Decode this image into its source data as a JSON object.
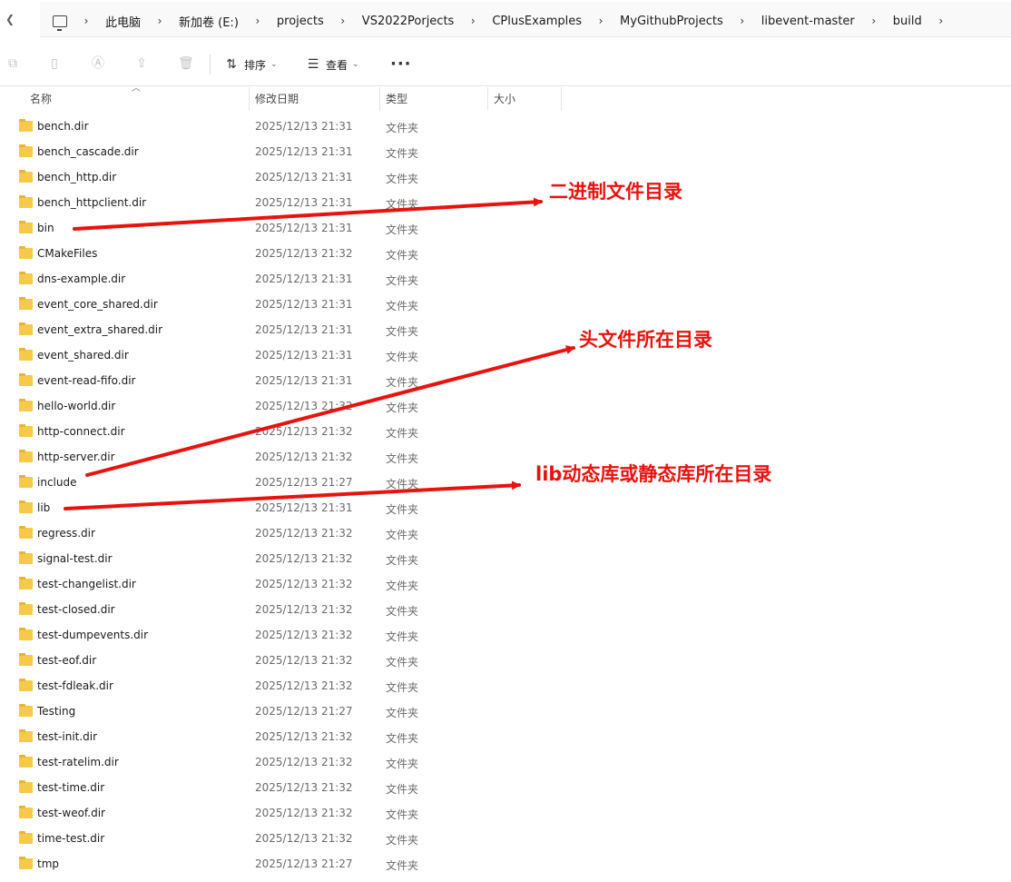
{
  "address_bar": {
    "crumbs": [
      "此电脑",
      "新加卷 (E:)",
      "projects",
      "VS2022Porjects",
      "CPlusExamples",
      "MyGithubProjects",
      "libevent-master",
      "build"
    ]
  },
  "toolbar": {
    "sort_label": "排序",
    "view_label": "查看",
    "more_label": "···"
  },
  "columns": {
    "name": "名称",
    "modified": "修改日期",
    "type": "类型",
    "size": "大小"
  },
  "files": [
    {
      "name": "bench.dir",
      "date": "2025/12/13 21:31",
      "type": "文件夹"
    },
    {
      "name": "bench_cascade.dir",
      "date": "2025/12/13 21:31",
      "type": "文件夹"
    },
    {
      "name": "bench_http.dir",
      "date": "2025/12/13 21:31",
      "type": "文件夹"
    },
    {
      "name": "bench_httpclient.dir",
      "date": "2025/12/13 21:31",
      "type": "文件夹"
    },
    {
      "name": "bin",
      "date": "2025/12/13 21:31",
      "type": "文件夹"
    },
    {
      "name": "CMakeFiles",
      "date": "2025/12/13 21:32",
      "type": "文件夹"
    },
    {
      "name": "dns-example.dir",
      "date": "2025/12/13 21:31",
      "type": "文件夹"
    },
    {
      "name": "event_core_shared.dir",
      "date": "2025/12/13 21:31",
      "type": "文件夹"
    },
    {
      "name": "event_extra_shared.dir",
      "date": "2025/12/13 21:31",
      "type": "文件夹"
    },
    {
      "name": "event_shared.dir",
      "date": "2025/12/13 21:31",
      "type": "文件夹"
    },
    {
      "name": "event-read-fifo.dir",
      "date": "2025/12/13 21:31",
      "type": "文件夹"
    },
    {
      "name": "hello-world.dir",
      "date": "2025/12/13 21:32",
      "type": "文件夹"
    },
    {
      "name": "http-connect.dir",
      "date": "2025/12/13 21:32",
      "type": "文件夹"
    },
    {
      "name": "http-server.dir",
      "date": "2025/12/13 21:32",
      "type": "文件夹"
    },
    {
      "name": "include",
      "date": "2025/12/13 21:27",
      "type": "文件夹"
    },
    {
      "name": "lib",
      "date": "2025/12/13 21:31",
      "type": "文件夹"
    },
    {
      "name": "regress.dir",
      "date": "2025/12/13 21:32",
      "type": "文件夹"
    },
    {
      "name": "signal-test.dir",
      "date": "2025/12/13 21:32",
      "type": "文件夹"
    },
    {
      "name": "test-changelist.dir",
      "date": "2025/12/13 21:32",
      "type": "文件夹"
    },
    {
      "name": "test-closed.dir",
      "date": "2025/12/13 21:32",
      "type": "文件夹"
    },
    {
      "name": "test-dumpevents.dir",
      "date": "2025/12/13 21:32",
      "type": "文件夹"
    },
    {
      "name": "test-eof.dir",
      "date": "2025/12/13 21:32",
      "type": "文件夹"
    },
    {
      "name": "test-fdleak.dir",
      "date": "2025/12/13 21:32",
      "type": "文件夹"
    },
    {
      "name": "Testing",
      "date": "2025/12/13 21:27",
      "type": "文件夹"
    },
    {
      "name": "test-init.dir",
      "date": "2025/12/13 21:32",
      "type": "文件夹"
    },
    {
      "name": "test-ratelim.dir",
      "date": "2025/12/13 21:32",
      "type": "文件夹"
    },
    {
      "name": "test-time.dir",
      "date": "2025/12/13 21:32",
      "type": "文件夹"
    },
    {
      "name": "test-weof.dir",
      "date": "2025/12/13 21:32",
      "type": "文件夹"
    },
    {
      "name": "time-test.dir",
      "date": "2025/12/13 21:32",
      "type": "文件夹"
    },
    {
      "name": "tmp",
      "date": "2025/12/13 21:27",
      "type": "文件夹"
    }
  ],
  "annotations": {
    "bin_note": "二进制文件目录",
    "include_note": "头文件所在目录",
    "lib_note": "lib动态库或静态库所在目录",
    "color": "#e8130f"
  },
  "colors": {
    "folder": "#f7c948",
    "arrow": "#e8130f"
  }
}
